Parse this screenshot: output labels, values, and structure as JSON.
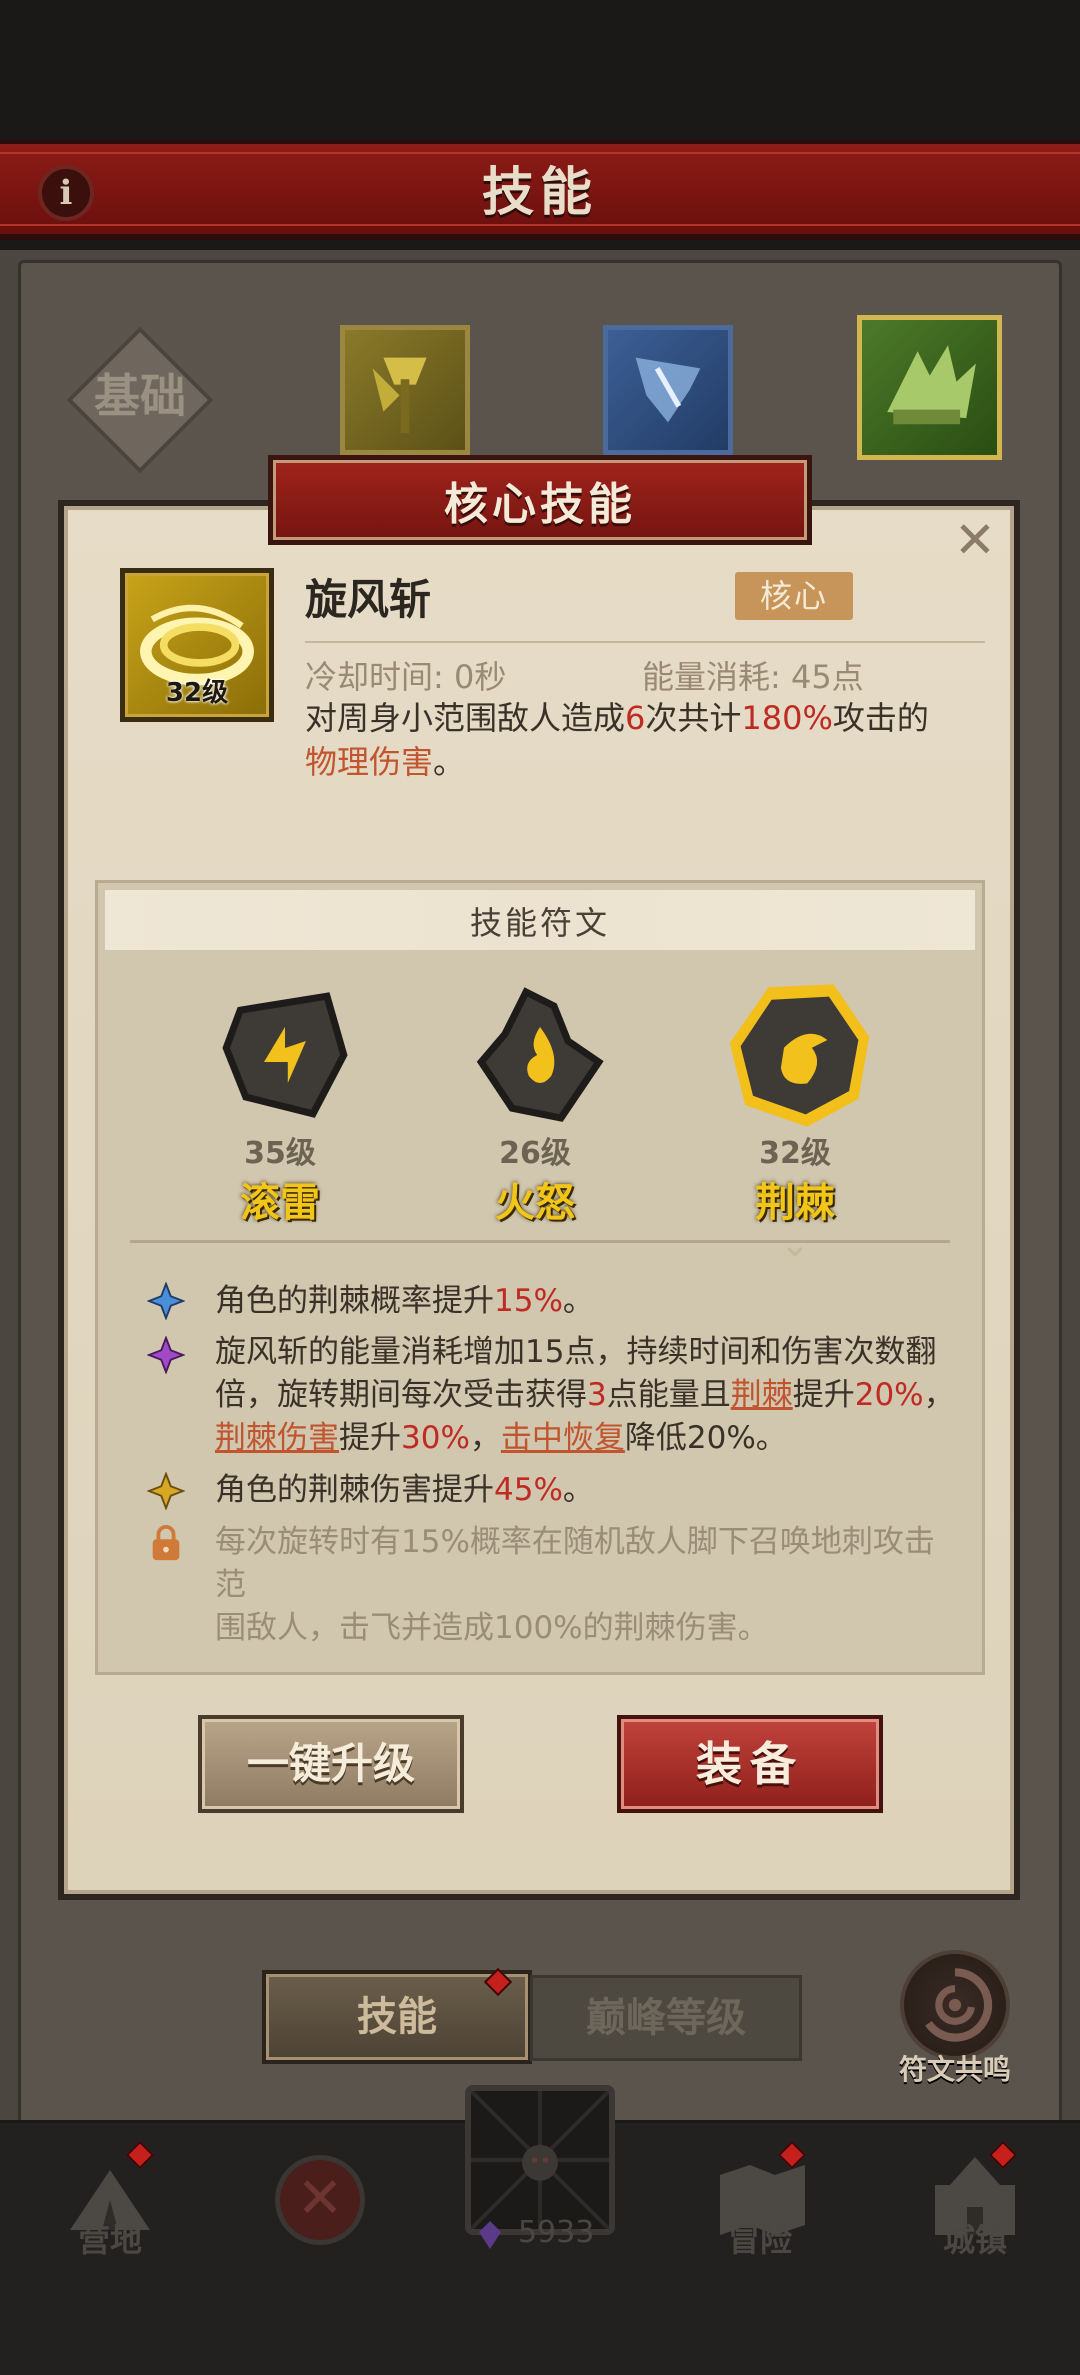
{
  "header": {
    "title": "技能",
    "info_icon": "info-icon"
  },
  "categories": {
    "basic_label": "基础",
    "items": [
      {
        "name": "axe-skill",
        "color": "#8a7a2a"
      },
      {
        "name": "ice-skill",
        "color": "#3c5f95"
      },
      {
        "name": "nature-skill",
        "color": "#4c7a2a",
        "selected": true
      }
    ]
  },
  "modal": {
    "banner": "核心技能",
    "close_icon": "close-icon",
    "skill": {
      "name": "旋风斩",
      "level": "32级",
      "badge": "核心",
      "cooldown": "冷却时间: 0秒",
      "energy": "能量消耗: 45点",
      "desc_1": "对周身小范围敌人造成",
      "desc_hits": "6",
      "desc_2": "次共计",
      "desc_pct": "180%",
      "desc_3": "攻击的",
      "desc_type": "物理伤害",
      "desc_4": "。"
    },
    "runes": {
      "title": "技能符文",
      "items": [
        {
          "level": "35级",
          "name": "滚雷",
          "icon": "thunder-rune-icon"
        },
        {
          "level": "26级",
          "name": "火怒",
          "icon": "fire-rune-icon"
        },
        {
          "level": "32级",
          "name": "荆棘",
          "icon": "thorns-rune-icon",
          "selected": true
        }
      ]
    },
    "effects": [
      {
        "icon": "blue-star-icon",
        "color": "#4a8fd8",
        "a": "角色的荆棘概率提升",
        "b": "15%",
        "c": "。"
      },
      {
        "icon": "purple-star-icon",
        "color": "#a04ac8",
        "l1": "旋风斩的能量消耗增加15点，持续时间和伤害次数翻",
        "l2a": "倍，旋转期间每次受击获得",
        "l2b": "3",
        "l2c": "点能量且",
        "l2d": "荆棘",
        "l2e": "提升",
        "l2f": "20%",
        "l2g": "，",
        "l3a": "荆棘伤害",
        "l3b": "提升",
        "l3c": "30%",
        "l3d": "，",
        "l3e": "击中恢复",
        "l3f": "降低20%。"
      },
      {
        "icon": "gold-star-icon",
        "color": "#d8a825",
        "a": "角色的荆棘伤害提升",
        "b": "45%",
        "c": "。"
      },
      {
        "icon": "lock-icon",
        "color": "#d07a3a",
        "l1": "每次旋转时有15%概率在随机敌人脚下召唤地刺攻击范",
        "l2": "围敌人，击飞并造成100%的荆棘伤害。"
      }
    ],
    "buttons": {
      "upgrade": "一键升级",
      "equip": "装备"
    }
  },
  "tabs": {
    "skill": "技能",
    "peak": "巅峰等级",
    "resonance": "符文共鸣"
  },
  "nav": {
    "camp": "营地",
    "adventure": "冒险",
    "town": "城镇",
    "gems": "5933"
  }
}
